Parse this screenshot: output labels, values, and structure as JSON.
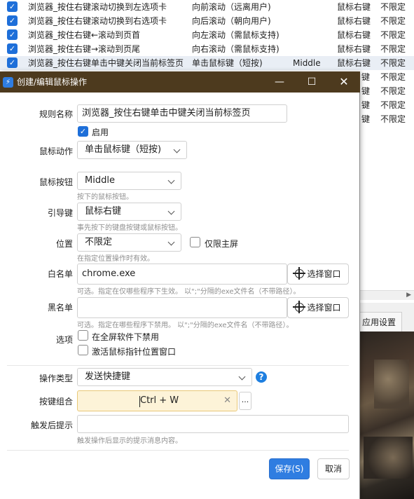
{
  "background_list": {
    "rows": [
      {
        "name": "浏览器_按住右键滚动切换到左选项卡",
        "action": "向前滚动（远离用户)",
        "button": "",
        "key": "鼠标右键",
        "position": "不限定",
        "selected": false
      },
      {
        "name": "浏览器_按住右键滚动切换到右选项卡",
        "action": "向后滚动（朝向用户)",
        "button": "",
        "key": "鼠标右键",
        "position": "不限定",
        "selected": false
      },
      {
        "name": "浏览器_按住右键←滚动到页首",
        "action": "向左滚动（需鼠标支持)",
        "button": "",
        "key": "鼠标右键",
        "position": "不限定",
        "selected": false
      },
      {
        "name": "浏览器_按住右键→滚动到页尾",
        "action": "向右滚动（需鼠标支持)",
        "button": "",
        "key": "鼠标右键",
        "position": "不限定",
        "selected": false
      },
      {
        "name": "浏览器_按住右键单击中键关闭当前标签页",
        "action": "单击鼠标键（短按)",
        "button": "Middle",
        "key": "鼠标右键",
        "position": "不限定",
        "selected": true
      }
    ],
    "right_column": [
      {
        "key": "键",
        "position": "不限定"
      },
      {
        "key": "键",
        "position": "不限定"
      },
      {
        "key": "键",
        "position": "不限定"
      },
      {
        "key": "键",
        "position": "不限定"
      }
    ],
    "tab_label": "应用设置"
  },
  "dialog": {
    "title": "创建/编辑鼠标操作",
    "titlebar_color": "#4d3a1e",
    "rule_name": {
      "label": "规则名称",
      "value": "浏览器_按住右键单击中键关闭当前标签页"
    },
    "enabled": {
      "label": "启用",
      "checked": true
    },
    "mouse_action": {
      "label": "鼠标动作",
      "value": "单击鼠标键（短按)"
    },
    "mouse_button": {
      "label": "鼠标按钮",
      "value": "Middle",
      "hint": "按下的鼠标按钮。"
    },
    "leader_key": {
      "label": "引导键",
      "value": "鼠标右键",
      "hint": "事先按下的键盘按键或鼠标按钮。"
    },
    "position": {
      "label": "位置",
      "value": "不限定",
      "hint": "在指定位置操作时有效。",
      "primary_only_label": "仅限主屏",
      "primary_only_checked": false
    },
    "whitelist": {
      "label": "白名单",
      "value": "chrome.exe",
      "select_button": "选择窗口",
      "hint": "可选。指定在仅哪些程序下生效。 以\";\"分隔的exe文件名（不带路径）。"
    },
    "blacklist": {
      "label": "黑名单",
      "value": "",
      "select_button": "选择窗口",
      "hint": "可选。指定在哪些程序下禁用。 以\";\"分隔的exe文件名（不带路径）。"
    },
    "options": {
      "label": "选项",
      "items": [
        {
          "label": "在全屏软件下禁用",
          "checked": false
        },
        {
          "label": "激活鼠标指针位置窗口",
          "checked": false
        }
      ]
    },
    "operation_type": {
      "label": "操作类型",
      "value": "发送快捷键",
      "help_icon": "question-icon"
    },
    "hotkey": {
      "label": "按键组合",
      "value": "Ctrl + W",
      "more_label": "..."
    },
    "post_prompt": {
      "label": "触发后提示",
      "value": "",
      "hint": "触发操作后显示的提示消息内容。"
    },
    "buttons": {
      "save": "保存(S)",
      "cancel": "取消"
    },
    "accent_color": "#2f7de1"
  }
}
